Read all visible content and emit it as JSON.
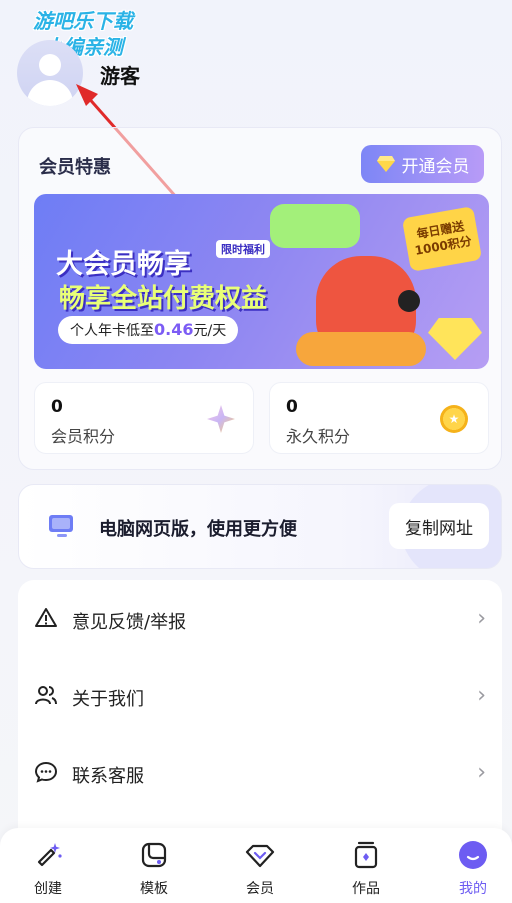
{
  "watermark": {
    "line1": "游吧乐下载",
    "line2": "小编亲测"
  },
  "profile": {
    "username": "游客"
  },
  "vip_section": {
    "title": "会员特惠",
    "open_button": "开通会员",
    "banner": {
      "headline1": "大会员畅享",
      "headline2": "畅享全站付费权益",
      "tag": "限时福利",
      "price_prefix": "个人年卡低至",
      "price_value": "0.46",
      "price_suffix": "元/天",
      "gift_line1": "每日赠送",
      "gift_line2": "1000积分"
    },
    "points": [
      {
        "value": "0",
        "label": "会员积分",
        "icon": "sparkle-gem-icon"
      },
      {
        "value": "0",
        "label": "永久积分",
        "icon": "coin-icon"
      }
    ]
  },
  "web_card": {
    "text": "电脑网页版，使用更方便",
    "button": "复制网址",
    "icon": "monitor-icon"
  },
  "menu": [
    {
      "label": "意见反馈/举报",
      "icon": "warning-icon"
    },
    {
      "label": "关于我们",
      "icon": "users-icon"
    },
    {
      "label": "联系客服",
      "icon": "chat-icon"
    }
  ],
  "tabbar": {
    "items": [
      {
        "label": "创建",
        "icon": "magic-wand-icon"
      },
      {
        "label": "模板",
        "icon": "template-icon"
      },
      {
        "label": "会员",
        "icon": "diamond-icon"
      },
      {
        "label": "作品",
        "icon": "works-icon"
      },
      {
        "label": "我的",
        "icon": "profile-icon"
      }
    ],
    "active": "我的"
  },
  "colors": {
    "accent": "#6d5cf2",
    "annotation_arrow": "#e02a2a"
  }
}
